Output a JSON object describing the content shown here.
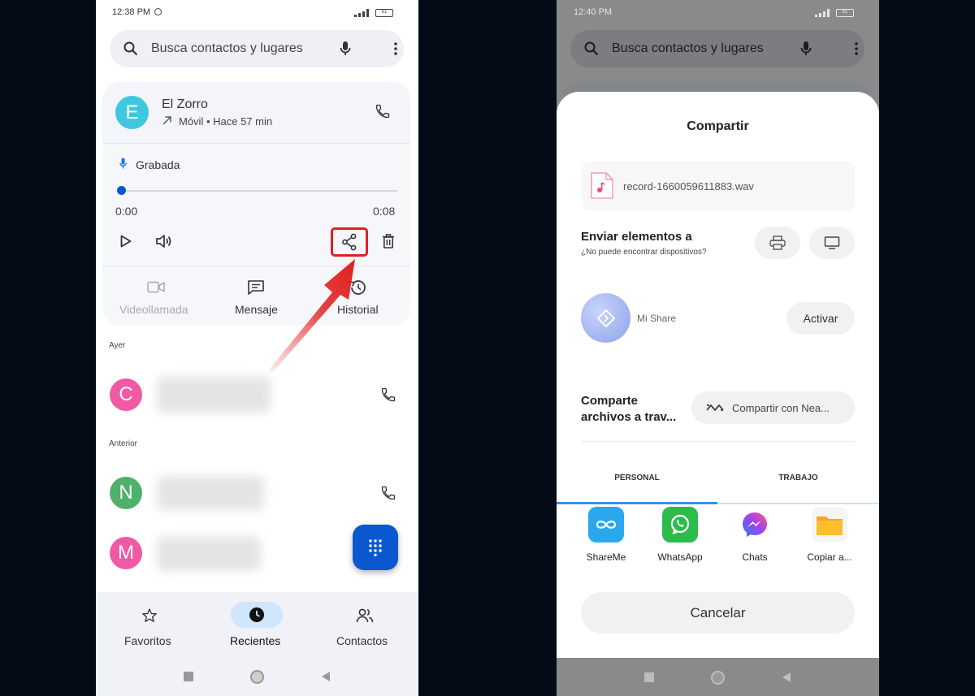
{
  "left": {
    "status": {
      "time": "12:38 PM",
      "battery": "61"
    },
    "search": {
      "placeholder": "Busca contactos y lugares"
    },
    "contact": {
      "initial": "E",
      "name": "El Zorro",
      "detail": "Móvil • Hace 57 min",
      "avatar_color": "#3fc7dd"
    },
    "recording": {
      "label": "Grabada",
      "time_start": "0:00",
      "time_end": "0:08",
      "progress": 0
    },
    "actions": {
      "video": "Videollamada",
      "message": "Mensaje",
      "history": "Historial"
    },
    "sections": {
      "yesterday": "Ayer",
      "earlier": "Anterior"
    },
    "calls": [
      {
        "initial": "C",
        "color": "#ef5aa3"
      },
      {
        "initial": "N",
        "color": "#4fb06a"
      },
      {
        "initial": "M",
        "color": "#ef5aa3"
      }
    ],
    "nav": {
      "favorites": "Favoritos",
      "recents": "Recientes",
      "contacts": "Contactos"
    },
    "highlight_color": "#e0201f",
    "accent": "#0b57d0"
  },
  "right": {
    "status": {
      "time": "12:40 PM",
      "battery": "61"
    },
    "search": {
      "placeholder": "Busca contactos y lugares"
    },
    "sheet": {
      "title": "Compartir",
      "file_name": "record-1660059611883.wav",
      "send_title": "Enviar elementos a",
      "send_subtitle": "¿No puede encontrar dispositivos?",
      "mishare_label": "Mi Share",
      "activate": "Activar",
      "share_title_1": "Comparte",
      "share_title_2": "archivos a trav...",
      "nearby": "Compartir con Nea...",
      "tab_personal": "PERSONAL",
      "tab_work": "TRABAJO",
      "apps": [
        "ShareMe",
        "WhatsApp",
        "Chats",
        "Copiar a..."
      ],
      "cancel": "Cancelar"
    },
    "tab_accent": "#3b8fe8"
  }
}
